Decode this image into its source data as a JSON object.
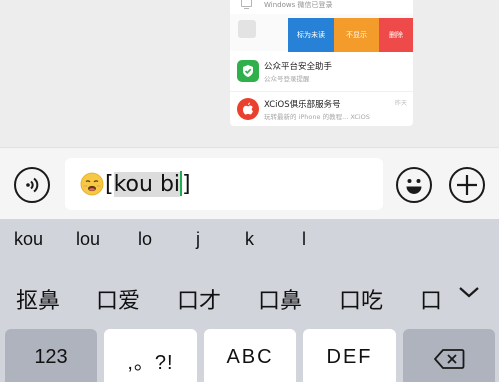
{
  "chat": {
    "card": {
      "top_title": "Windows 微信已登录",
      "row2_sub": "",
      "actions": {
        "mark_unread": "标为未读",
        "hide": "不显示",
        "delete": "删除"
      },
      "rows": [
        {
          "title": "公众平台安全助手",
          "subtitle": "公众号登录提醒",
          "time": "",
          "icon": "shield-icon"
        },
        {
          "title": "XCiOS俱乐部服务号",
          "subtitle": "玩转最新的 iPhone 的教程... XCiOS",
          "time": "昨天",
          "icon": "apple-icon"
        }
      ]
    }
  },
  "input_bar": {
    "text_bracket_open": "[",
    "text_marked": "kou bi",
    "text_bracket_close": "]",
    "emoji_prefix_icon": "weary-face-emoji"
  },
  "keyboard": {
    "pinyin_suggestions": [
      "kou",
      "lou",
      "lo",
      "j",
      "k",
      "l"
    ],
    "candidates": [
      "抠鼻",
      "口爱",
      "口才",
      "口鼻",
      "口吃",
      "口"
    ],
    "keys": {
      "numbers": "123",
      "punctuation": ",。?!",
      "abc": "ABC",
      "def": "DEF"
    }
  }
}
